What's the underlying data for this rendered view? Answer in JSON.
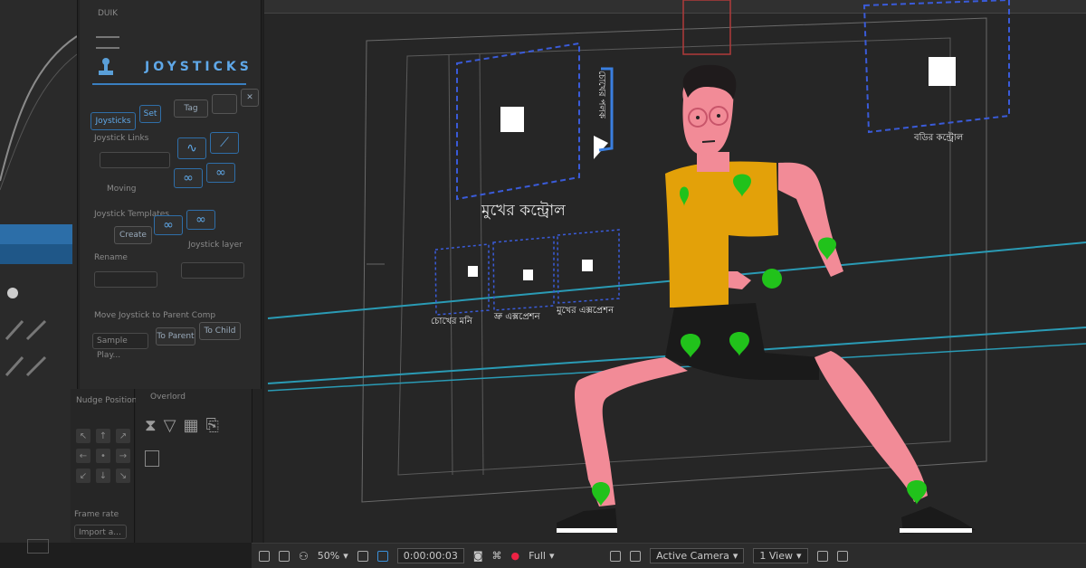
{
  "left_panel": {
    "panel_title": "DUIK",
    "tool_title": "JOYSTICKS",
    "tabs": [
      "Joysticks",
      "Set",
      "Tag"
    ],
    "link_label": "Joystick Links",
    "joystick_templates_label": "Joystick Templates",
    "create_label": "Create",
    "joystick_layer_label": "Joystick layer",
    "rename_label": "Rename",
    "parent_label": "Move Joystick to Parent Comp",
    "to_parent_label": "To Parent",
    "to_child_label": "To Child",
    "sample_value": "Sample Play...",
    "moving_label": "Moving",
    "nudge_panel_title": "Nudge Position",
    "overlord_title": "Overlord",
    "fps_label": "Frame rate",
    "fps_value": "Import a..."
  },
  "viewer": {
    "face_control_label": "মুখের কন্ট্রোল",
    "eyelid_label": "চোখের পলক",
    "eye_pupil_label": "চোখের মনি",
    "brow_expression_label": "ভ্রু এক্সপ্রেশন",
    "mouth_expression_label": "মুখের এক্সপ্রেশন",
    "body_control_label": "বডির কন্ট্রোল"
  },
  "bottom_bar": {
    "zoom": "50%",
    "timecode": "0:00:00:03",
    "resolution": "Full",
    "camera": "Active Camera",
    "views": "1 View"
  },
  "colors": {
    "accent_blue": "#3a5bd9",
    "highlight_cyan": "#2a9bb5",
    "skin": "#f28b97",
    "shirt": "#e3a109",
    "pin_green": "#21c21b",
    "hair": "#1f1b1c"
  }
}
